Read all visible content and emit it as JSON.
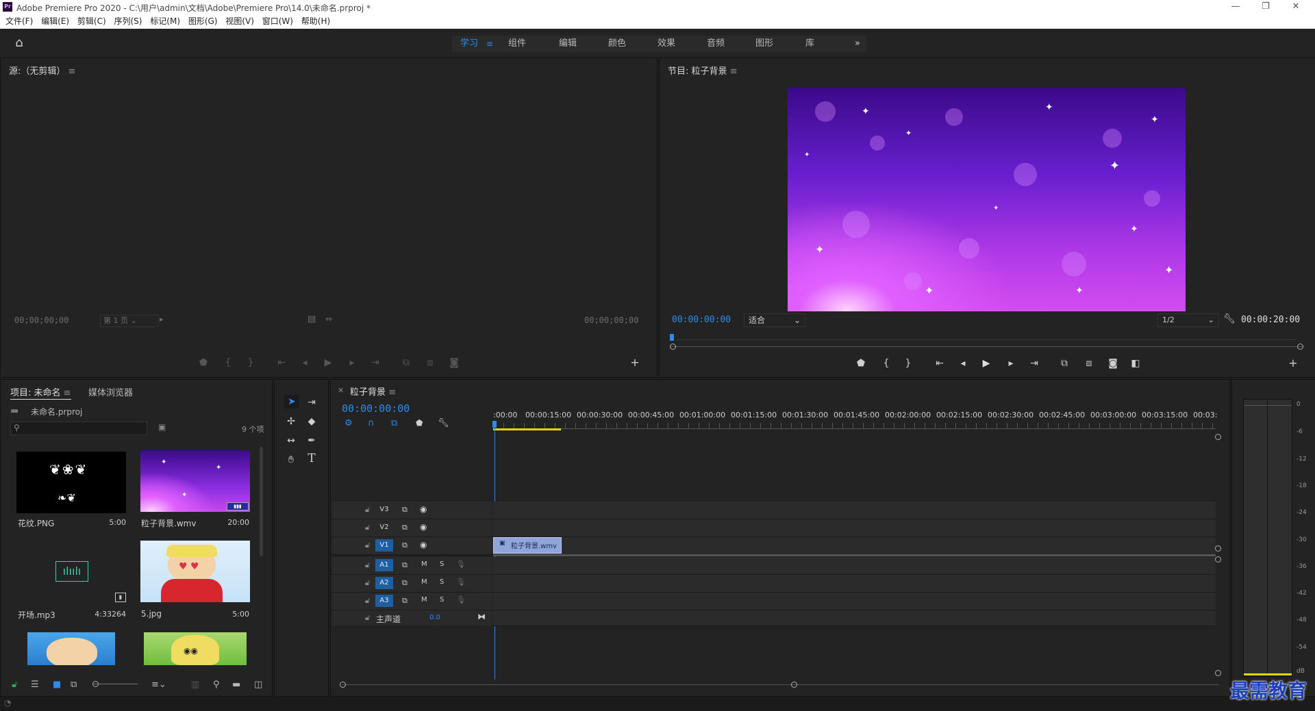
{
  "window": {
    "title": "Adobe Premiere Pro 2020 - C:\\用户\\admin\\文档\\Adobe\\Premiere Pro\\14.0\\未命名.prproj *",
    "app_icon": "Pr"
  },
  "menu": [
    "文件(F)",
    "编辑(E)",
    "剪辑(C)",
    "序列(S)",
    "标记(M)",
    "图形(G)",
    "视图(V)",
    "窗口(W)",
    "帮助(H)"
  ],
  "workspaces": {
    "tabs": [
      "学习",
      "组件",
      "编辑",
      "颜色",
      "效果",
      "音频",
      "图形",
      "库"
    ],
    "active": "学习",
    "overflow": "»"
  },
  "source_monitor": {
    "title": "源:（无剪辑）",
    "timecode_left": "00;00;00;00",
    "page_label": "第 1 页",
    "timecode_right": "00;00;00;00"
  },
  "program_monitor": {
    "title": "节目: 粒子背景",
    "timecode": "00:00:00:00",
    "zoom": "适合",
    "resolution": "1/2",
    "duration": "00:00:20:00"
  },
  "project_panel": {
    "tab_project": "项目: 未命名",
    "tab_media": "媒体浏览器",
    "file": "未命名.prproj",
    "item_count": "9 个项",
    "items": [
      {
        "name": "花纹.PNG",
        "duration": "5:00"
      },
      {
        "name": "粒子背景.wmv",
        "duration": "20:00"
      },
      {
        "name": "开场.mp3",
        "duration": "4:33264"
      },
      {
        "name": "5.jpg",
        "duration": "5:00"
      }
    ]
  },
  "timeline": {
    "sequence": "粒子背景",
    "timecode": "00:00:00:00",
    "ruler": [
      ":00:00",
      "00:00:15:00",
      "00:00:30:00",
      "00:00:45:00",
      "00:01:00:00",
      "00:01:15:00",
      "00:01:30:00",
      "00:01:45:00",
      "00:02:00:00",
      "00:02:15:00",
      "00:02:30:00",
      "00:02:45:00",
      "00:03:00:00",
      "00:03:15:00",
      "00:03:"
    ],
    "video_tracks": [
      "V3",
      "V2",
      "V1"
    ],
    "audio_tracks": [
      "A1",
      "A2",
      "A3"
    ],
    "master_label": "主声道",
    "master_value": "0.0",
    "mute": "M",
    "solo": "S",
    "clip_name": "粒子背景.wmv"
  },
  "meter": {
    "scale": [
      "0",
      "-6",
      "-12",
      "-18",
      "-24",
      "-30",
      "-36",
      "-42",
      "-48",
      "-54",
      "dB"
    ]
  },
  "watermark": "最需教育",
  "colors": {
    "accent": "#2d8ceb",
    "panel": "#232323",
    "track_on": "#1f5fa0"
  }
}
